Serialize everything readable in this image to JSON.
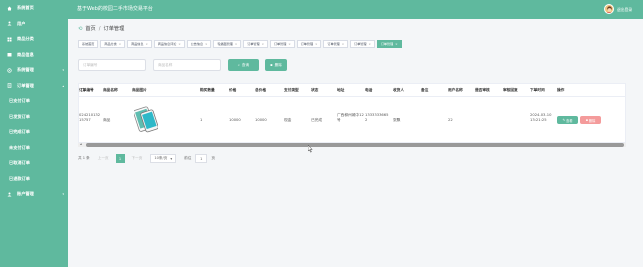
{
  "app": {
    "title": "基于Web的校园二手市场交易平台",
    "user": "退出登录"
  },
  "sidebar": {
    "items": [
      {
        "label": "系统首页",
        "icon": "home-icon"
      },
      {
        "label": "用户",
        "icon": "user-icon"
      },
      {
        "label": "商品分类",
        "icon": "category-icon"
      },
      {
        "label": "商品信息",
        "icon": "goods-icon"
      },
      {
        "label": "系统管理",
        "icon": "settings-icon"
      },
      {
        "label": "订单管理",
        "icon": "order-icon"
      }
    ],
    "sub_items": [
      "已支付订单",
      "已发货订单",
      "已完成订单",
      "未支付订单",
      "已取消订单",
      "已退款订单"
    ],
    "bottom_item": {
      "label": "账户管理",
      "icon": "account-icon"
    }
  },
  "breadcrumb": {
    "home": "首页",
    "current": "订单管理"
  },
  "tabs": [
    {
      "label": "系统首页"
    },
    {
      "label": "商品分类"
    },
    {
      "label": "商品信息"
    },
    {
      "label": "商品信息评论"
    },
    {
      "label": "公告信息"
    },
    {
      "label": "轮播图管理"
    },
    {
      "label": "订单管理"
    },
    {
      "label": "订单管理"
    },
    {
      "label": "订单管理"
    },
    {
      "label": "订单管理"
    },
    {
      "label": "订单管理"
    },
    {
      "label": "订单管理",
      "active": true
    }
  ],
  "search": {
    "order_placeholder": "订单编号",
    "name_placeholder": "商品名称",
    "query_label": "查询",
    "delete_label": "删除"
  },
  "table": {
    "headers": [
      "订单编号",
      "商品名称",
      "商品图片",
      "购买数量",
      "价格",
      "总价格",
      "支付类型",
      "状态",
      "地址",
      "电话",
      "收货人",
      "备注",
      "用户名称",
      "是否审核",
      "审核回复",
      "下单时间",
      "操作"
    ],
    "row": {
      "order_no": "024210132\n15757",
      "name": "商品",
      "qty": "1",
      "price": "10000",
      "total": "10000",
      "pay_type": "现金",
      "status": "已完成",
      "address": "广西柳州城中12\n号",
      "phone": "1333333665\n2",
      "receiver": "张飘",
      "user": "22",
      "time": "2024-03-10\n13:21:25",
      "edit_label": "查看",
      "delete_label": "删除"
    }
  },
  "pagination": {
    "total": "共 1 条",
    "prev": "上一页",
    "page": "1",
    "next": "下一页",
    "size": "10条/页",
    "goto": "前往",
    "goto_value": "1",
    "page_unit": "页"
  },
  "colors": {
    "primary": "#5fb99e",
    "danger": "#f49b9b"
  }
}
